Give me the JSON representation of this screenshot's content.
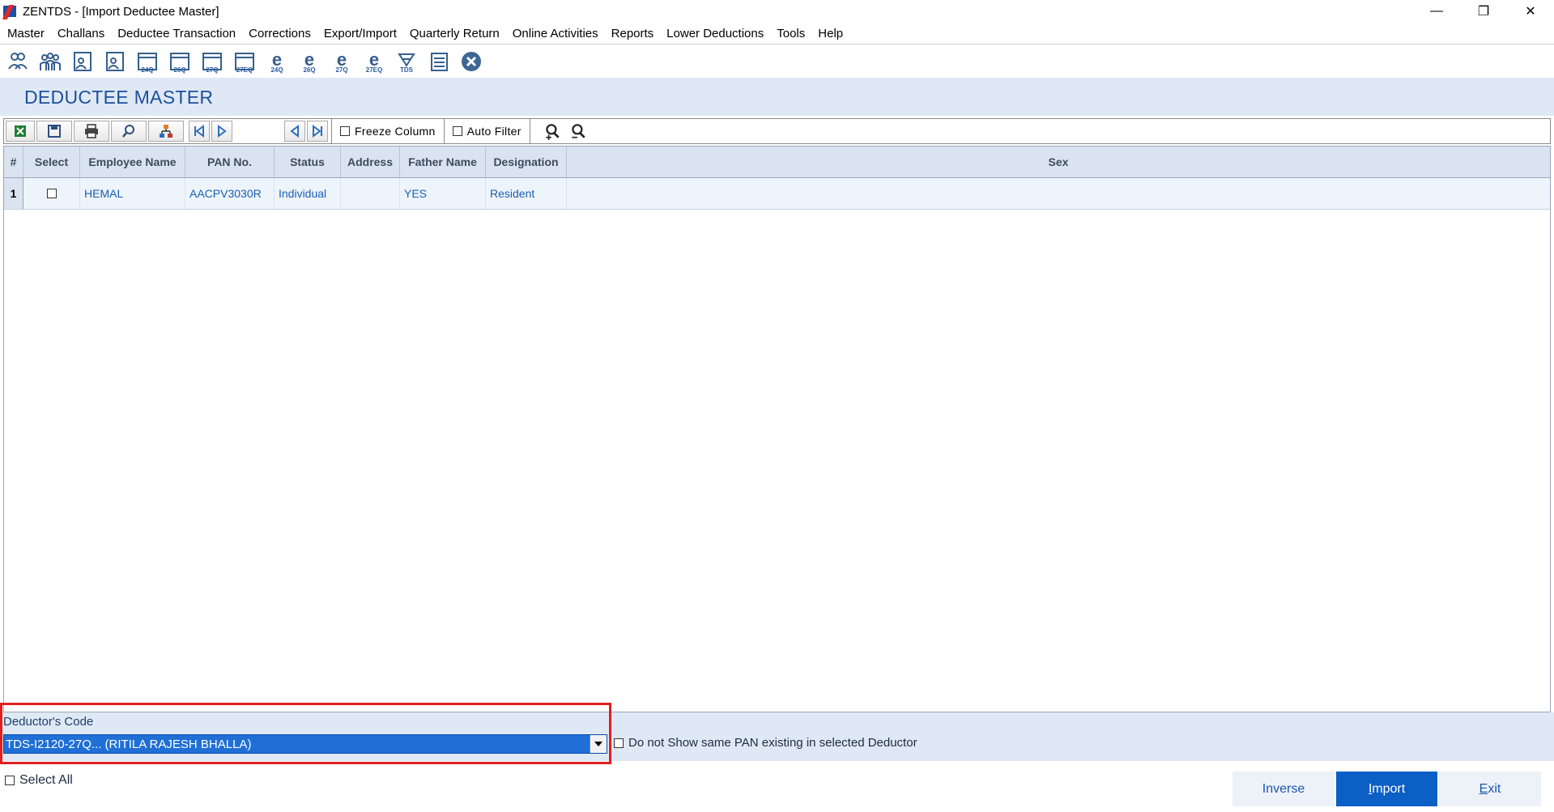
{
  "window": {
    "title": "ZENTDS - [Import Deductee Master]",
    "controls": [
      "—",
      "❐",
      "✕"
    ]
  },
  "menu": [
    "Master",
    "Challans",
    "Deductee Transaction",
    "Corrections",
    "Export/Import",
    "Quarterly Return",
    "Online Activities",
    "Reports",
    "Lower Deductions",
    "Tools",
    "Help"
  ],
  "toolbar_labels": {
    "f24q": "24Q",
    "f26q": "26Q",
    "f27q": "27Q",
    "f27eq": "27EQ",
    "e24q": "24Q",
    "e26q": "26Q",
    "e27q": "27Q",
    "e27eq": "27EQ",
    "tds": "TDS"
  },
  "page": {
    "title": "DEDUCTEE MASTER"
  },
  "grid_toolbar": {
    "freeze_column": "Freeze Column",
    "auto_filter": "Auto Filter"
  },
  "grid": {
    "columns": [
      "#",
      "Select",
      "Employee Name",
      "PAN No.",
      "Status",
      "Address",
      "Father Name",
      "Designation",
      "Sex"
    ],
    "rows": [
      {
        "num": "1",
        "employee_name": "HEMAL",
        "pan": "AACPV3030R",
        "status": "Individual",
        "address": "",
        "father_name": "YES",
        "designation": "Resident",
        "sex": ""
      }
    ]
  },
  "bottom": {
    "deductor_label": "Deductor's Code",
    "deductor_value": "TDS-I2120-27Q... (RITILA RAJESH BHALLA)",
    "same_pan_label": "Do not Show same PAN existing in selected Deductor",
    "select_all_label": "Select All"
  },
  "buttons": {
    "inverse": "Inverse",
    "import": "Import",
    "exit": "Exit"
  },
  "colors": {
    "accent": "#0c5fc4",
    "title": "#1f4f9a",
    "highlight": "#e02020",
    "header_band": "#dfe9f5"
  }
}
